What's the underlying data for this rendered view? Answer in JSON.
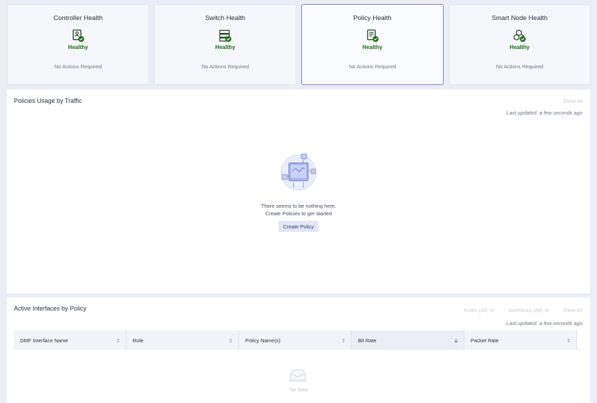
{
  "health_cards": [
    {
      "title": "Controller Health",
      "icon": "controller-doc-icon",
      "status": "Healthy",
      "actions": "No Actions Required"
    },
    {
      "title": "Switch Health",
      "icon": "switch-server-icon",
      "status": "Healthy",
      "actions": "No Actions Required"
    },
    {
      "title": "Policy Health",
      "icon": "policy-doc-icon",
      "status": "Healthy",
      "actions": "No Actions Required"
    },
    {
      "title": "Smart Node Health",
      "icon": "smart-node-cubes-icon",
      "status": "Healthy",
      "actions": "No Actions Required"
    }
  ],
  "policies_usage": {
    "title": "Policies Usage by Traffic",
    "show_all": "Show All",
    "last_updated": "Last updated: a few seconds ago",
    "empty_line1": "There seems to be nothing here.",
    "empty_line2": "Create Policies to get started",
    "create_button": "Create Policy"
  },
  "active_interfaces": {
    "title": "Active Interfaces by Policy",
    "roles_filter": "Roles (All)",
    "interfaces_filter": "Interfaces (All)",
    "show_all": "Show All",
    "last_updated": "Last updated: a few seconds ago",
    "columns": [
      "DMF Interface Name",
      "Role",
      "Policy Name(s)",
      "Bit Rate",
      "Packet Rate"
    ],
    "no_data": "No data"
  },
  "colors": {
    "healthy": "#1f6b1a",
    "accent": "#3b4377",
    "selected_border": "#8a8fc4"
  }
}
